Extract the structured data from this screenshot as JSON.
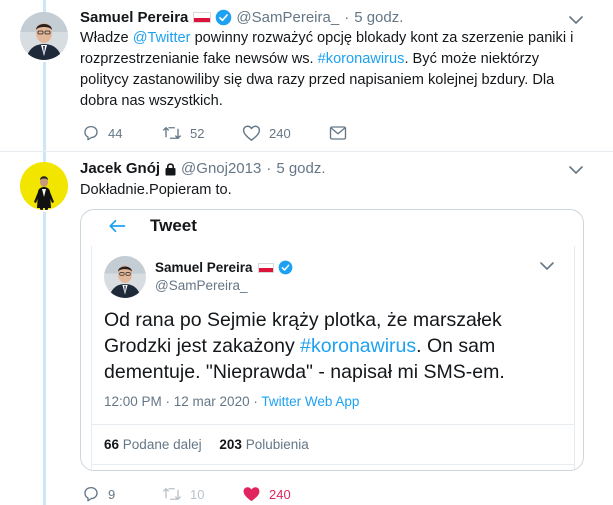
{
  "tweet1": {
    "author_name": "Samuel Pereira",
    "handle": "@SamPereira_",
    "separator": "·",
    "time": "5 godz.",
    "text_a": "Władze ",
    "mention": "@Twitter",
    "text_b": " powinny rozważyć opcję blokady kont za szerzenie paniki i rozprzestrzenianie fake newsów ws. ",
    "hashtag": "#koronawirus",
    "text_c": ". Być może niektórzy politycy zastanowiliby się dwa razy przed napisaniem kolejnej bzdury. Dla dobra nas wszystkich.",
    "replies": "44",
    "retweets": "52",
    "likes": "240"
  },
  "tweet2": {
    "author_name": "Jacek Gnój",
    "handle": "@Gnoj2013",
    "separator": "·",
    "time": "5 godz.",
    "text": "Dokładnie.Popieram to.",
    "replies": "9",
    "retweets": "10",
    "likes": "240"
  },
  "embedded": {
    "header_title": "Tweet",
    "author_name": "Samuel Pereira",
    "handle": "@SamPereira_",
    "text_a": "Od rana po Sejmie krąży plotka, że marszałek Grodzki jest zakażony ",
    "hashtag": "#koronawirus",
    "text_b": ". On sam dementuje. \"Nieprawda\" - napisał mi SMS-em.",
    "timestamp": "12:00 PM · 12 mar 2020 · ",
    "source": "Twitter Web App",
    "retweets_count": "66",
    "retweets_label": "Podane dalej",
    "likes_count": "203",
    "likes_label": "Polubienia"
  },
  "colors": {
    "accent": "#1da1f2",
    "like_active": "#e0245e",
    "muted": "#657786",
    "thread_line": "#cce6f6"
  }
}
